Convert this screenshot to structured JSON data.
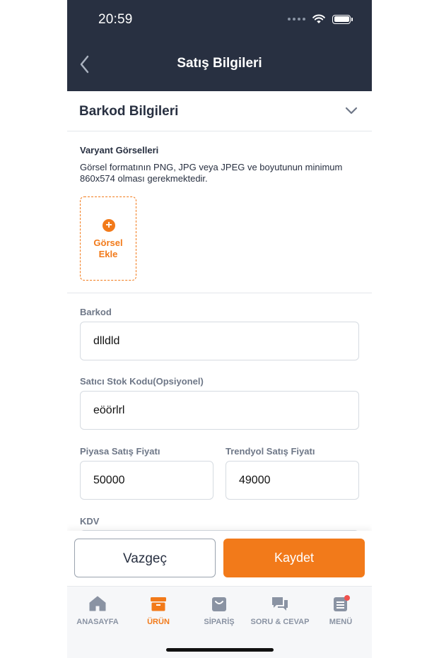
{
  "status": {
    "time": "20:59"
  },
  "header": {
    "title": "Satış Bilgileri"
  },
  "section": {
    "title": "Barkod Bilgileri"
  },
  "variant": {
    "title": "Varyant Görselleri",
    "description": "Görsel formatının PNG, JPG veya JPEG ve boyutunun minimum 860x574 olması gerekmektedir.",
    "add_label": "Görsel\nEkle"
  },
  "form": {
    "barcode_label": "Barkod",
    "barcode_value": "dlldld",
    "stock_code_label": "Satıcı Stok Kodu(Opsiyonel)",
    "stock_code_value": "eöörlrl",
    "market_price_label": "Piyasa Satış Fiyatı",
    "market_price_value": "50000",
    "trendyol_price_label": "Trendyol Satış Fiyatı",
    "trendyol_price_value": "49000",
    "kdv_label": "KDV"
  },
  "actions": {
    "cancel_label": "Vazgeç",
    "save_label": "Kaydet"
  },
  "tabs": [
    {
      "label": "ANASAYFA",
      "icon": "home-icon",
      "active": false
    },
    {
      "label": "ÜRÜN",
      "icon": "box-icon",
      "active": true
    },
    {
      "label": "SİPARİŞ",
      "icon": "shopping-bag-icon",
      "active": false
    },
    {
      "label": "SORU & CEVAP",
      "icon": "chat-icon",
      "active": false
    },
    {
      "label": "MENÜ",
      "icon": "menu-icon",
      "active": false
    }
  ],
  "colors": {
    "brand": "#f27a1a",
    "header_bg": "#283041",
    "notification": "#f0524e"
  }
}
